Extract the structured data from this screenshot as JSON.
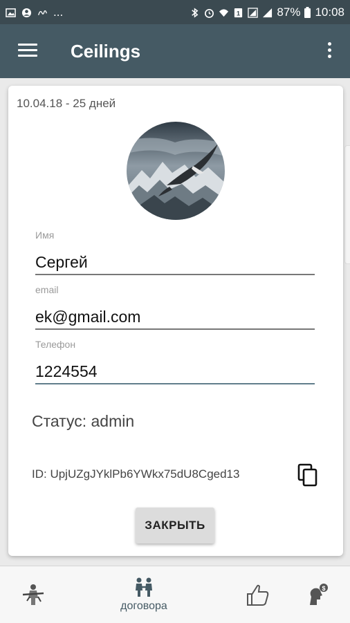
{
  "statusbar": {
    "left_icons": [
      "image-icon",
      "account-circle-icon",
      "handwriting-icon"
    ],
    "left_more": "...",
    "battery_percent": "87%",
    "time": "10:08"
  },
  "appbar": {
    "title": "Ceilings",
    "menu_icon": "hamburger-icon",
    "more_icon": "more-vert-icon"
  },
  "card": {
    "date_text": "10.04.18 - 25 дней",
    "avatar_icon": "eagle-over-mountains-image",
    "name_label": "Имя",
    "name_value": "Сергей",
    "email_label": "email",
    "email_value": "ek@gmail.com",
    "phone_label": "Телефон",
    "phone_value": "1224554",
    "status_text": "Статус: admin",
    "id_text": "ID: UpjUZgJYklPb6YWkx75dU8Cged13",
    "copy_icon": "copy-icon",
    "close_button": "ЗАКРЫТЬ"
  },
  "bottomnav": {
    "items": [
      {
        "icon": "worker-with-tool-icon",
        "label": ""
      },
      {
        "icon": "contract-people-icon",
        "label": "договора"
      },
      {
        "icon": "thumbs-up-icon",
        "label": ""
      },
      {
        "icon": "head-dollar-icon",
        "label": ""
      }
    ]
  },
  "colors": {
    "statusbar": "#3b4a51",
    "appbar": "#455a64",
    "accent": "#607d8b",
    "background": "#eaeaea"
  }
}
